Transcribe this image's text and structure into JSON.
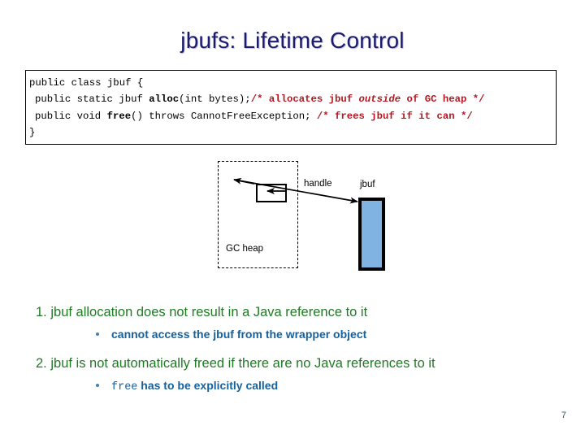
{
  "slide": {
    "title": "jbufs: Lifetime Control",
    "page_number": "7",
    "title_color": "#1b1b6f"
  },
  "code_block": {
    "lines": [
      {
        "indent": 0,
        "segments": [
          {
            "text": "public class jbuf {",
            "style": "plain"
          }
        ]
      },
      {
        "indent": 1,
        "segments": [
          {
            "text": "public static jbuf ",
            "style": "plain"
          },
          {
            "text": "alloc",
            "style": "bold"
          },
          {
            "text": "(int bytes);",
            "style": "plain"
          },
          {
            "text": "/* allocates jbuf ",
            "style": "comment"
          },
          {
            "text": "outside",
            "style": "comment-italic"
          },
          {
            "text": " of GC heap */",
            "style": "comment"
          }
        ]
      },
      {
        "indent": 1,
        "segments": [
          {
            "text": "public void ",
            "style": "plain"
          },
          {
            "text": "free",
            "style": "bold"
          },
          {
            "text": "() throws CannotFreeException; ",
            "style": "plain"
          },
          {
            "text": "/* frees jbuf if it can */",
            "style": "comment"
          }
        ]
      },
      {
        "indent": 0,
        "segments": [
          {
            "text": "}",
            "style": "plain"
          }
        ]
      }
    ],
    "comment_color": "#b51722"
  },
  "diagram": {
    "gc_heap_label": "GC heap",
    "handle_label": "handle",
    "jbuf_label": "jbuf",
    "jbuf_fill_color": "#80b3e2",
    "arrow_color": "#000000"
  },
  "bullets": [
    {
      "number": "1.",
      "text": "jbuf allocation does not result in a Java reference to it",
      "sub": {
        "mono_prefix": "",
        "text": "cannot access the jbuf from the wrapper object"
      }
    },
    {
      "number": "2.",
      "text": "jbuf is not automatically freed if there are no Java references to it",
      "sub": {
        "mono_prefix": "free",
        "text": " has to be explicitly called"
      }
    }
  ]
}
